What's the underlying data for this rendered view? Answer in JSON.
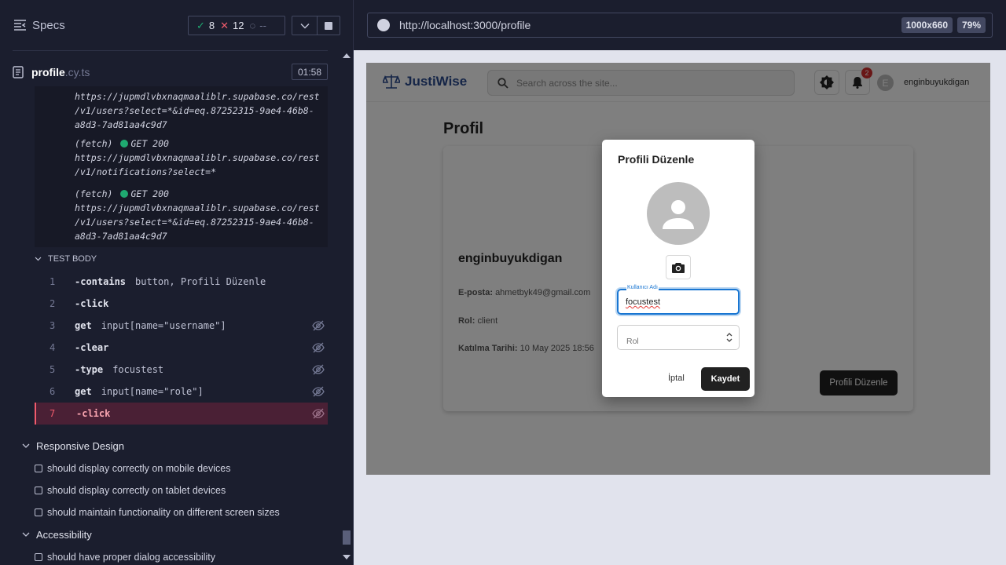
{
  "reporter": {
    "specs_label": "Specs",
    "stats": {
      "passed": "8",
      "failed": "12",
      "pending": "--"
    },
    "spec": {
      "name": "profile",
      "ext": ".cy.ts",
      "duration": "01:58"
    },
    "logs": [
      {
        "lines": [
          "https://jupmdlvbxnaqmaaliblr.supabase.co/rest",
          "/v1/users?select=*&id=eq.87252315-9ae4-46b8-",
          "a8d3-7ad81aa4c9d7"
        ]
      },
      {
        "fetch": "(fetch)",
        "status": "GET 200",
        "lines": [
          "https://jupmdlvbxnaqmaaliblr.supabase.co/rest",
          "/v1/notifications?select=*"
        ]
      },
      {
        "fetch": "(fetch)",
        "status": "GET 200",
        "lines": [
          "https://jupmdlvbxnaqmaaliblr.supabase.co/rest",
          "/v1/users?select=*&id=eq.87252315-9ae4-46b8-",
          "a8d3-7ad81aa4c9d7"
        ]
      }
    ],
    "test_body_label": "TEST BODY",
    "commands": [
      {
        "num": "1",
        "name": "-contains",
        "msg": "button, Profili Düzenle"
      },
      {
        "num": "2",
        "name": "-click",
        "msg": ""
      },
      {
        "num": "3",
        "name": "get",
        "msg": "input[name=\"username\"]"
      },
      {
        "num": "4",
        "name": "-clear",
        "msg": ""
      },
      {
        "num": "5",
        "name": "-type",
        "msg": "focustest"
      },
      {
        "num": "6",
        "name": "get",
        "msg": "input[name=\"role\"]"
      },
      {
        "num": "7",
        "name": "-click",
        "msg": ""
      }
    ],
    "suites": [
      {
        "title": "Responsive Design",
        "tests": [
          "should display correctly on mobile devices",
          "should display correctly on tablet devices",
          "should maintain functionality on different screen sizes"
        ]
      },
      {
        "title": "Accessibility",
        "tests": [
          "should have proper dialog accessibility"
        ]
      }
    ]
  },
  "aut": {
    "url": "http://localhost:3000/profile",
    "viewport_size": "1000x660",
    "zoom": "79%",
    "app": {
      "logo": "JustiWise",
      "search_placeholder": "Search across the site...",
      "notif_count": "2",
      "avatar_letter": "E",
      "username": "enginbuyukdigan",
      "page_title": "Profil",
      "profile_name": "enginbuyukdigan",
      "email_label": "E-posta:",
      "email_value": "ahmetbyk49@gmail.com",
      "role_label": "Rol:",
      "role_value": "client",
      "joined_label": "Katılma Tarihi:",
      "joined_value": "10 May 2025 18:56",
      "edit_button": "Profili Düzenle"
    },
    "dialog": {
      "title": "Profili Düzenle",
      "username_label": "Kullanıcı Adı",
      "username_value": "focustest",
      "role_placeholder": "Rol",
      "cancel": "İptal",
      "save": "Kaydet"
    }
  },
  "colors": {
    "pass": "#1fa971",
    "fail": "#f15b6c",
    "accent_blue": "#1976d2",
    "logo_blue": "#2a4a8f"
  }
}
